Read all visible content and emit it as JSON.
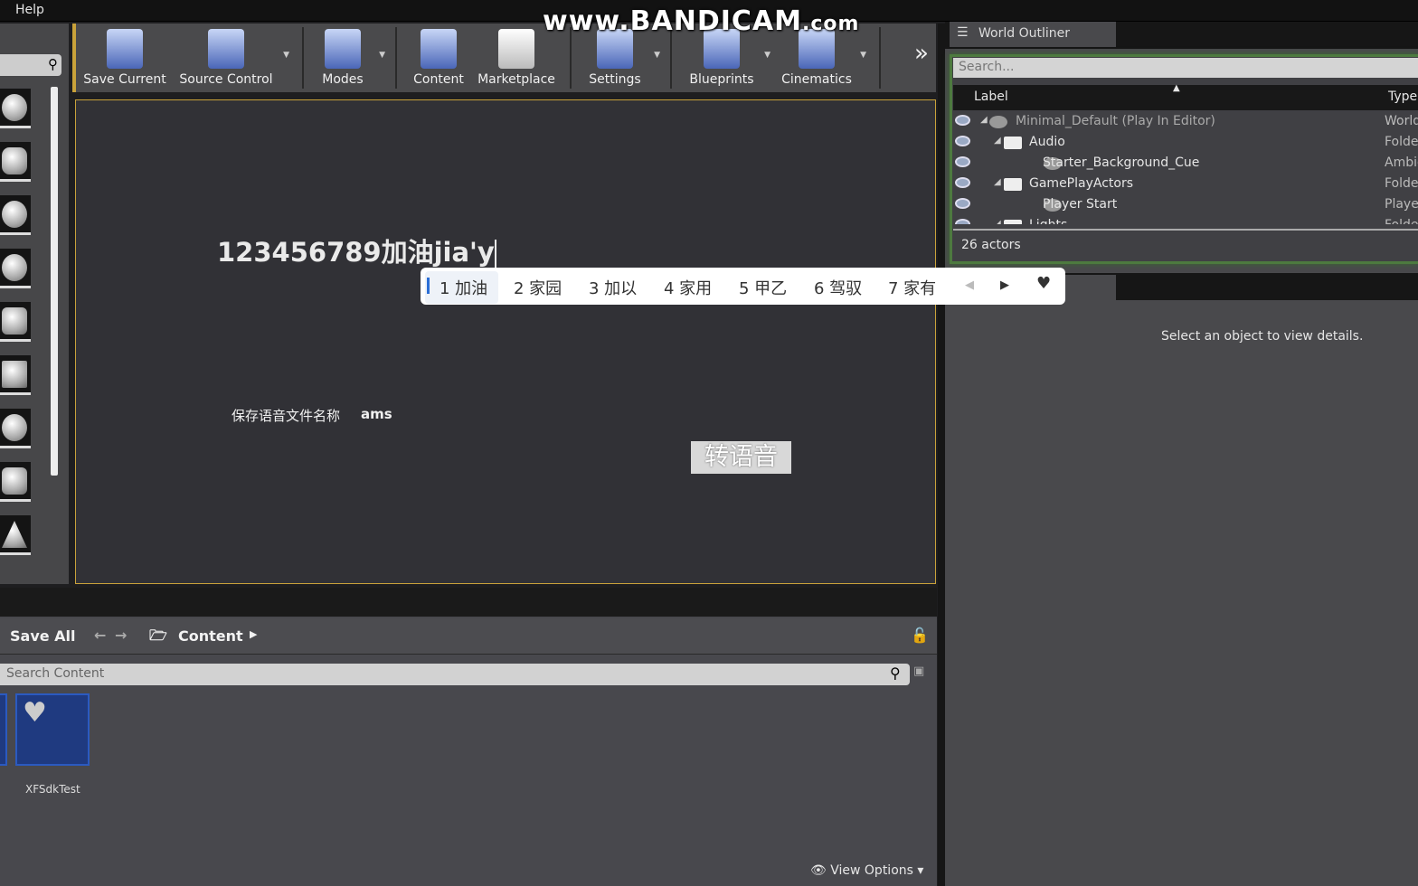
{
  "menu": {
    "help": "Help"
  },
  "watermark": {
    "main": "www.BANDICAM",
    "suffix": ".com"
  },
  "toolbar": {
    "items": [
      {
        "label": "Save Current",
        "icon": "save-icon",
        "dropdown": false
      },
      {
        "label": "Source Control",
        "icon": "source-control-icon",
        "dropdown": true
      },
      {
        "label": "Modes",
        "icon": "modes-icon",
        "dropdown": true
      },
      {
        "label": "Content",
        "icon": "content-icon",
        "dropdown": false
      },
      {
        "label": "Marketplace",
        "icon": "marketplace-icon",
        "dropdown": false
      },
      {
        "label": "Settings",
        "icon": "settings-icon",
        "dropdown": true
      },
      {
        "label": "Blueprints",
        "icon": "blueprints-icon",
        "dropdown": true
      },
      {
        "label": "Cinematics",
        "icon": "cinematics-icon",
        "dropdown": true
      }
    ],
    "more": "»"
  },
  "viewport": {
    "input_text": "123456789加油jia'y",
    "ime_candidates": [
      "1 加油",
      "2 家园",
      "3 加以",
      "4 家用",
      "5 甲乙",
      "6 驾驭",
      "7 家有"
    ],
    "save_label": "保存语音文件名称",
    "save_value": "ams",
    "convert_button": "转语音"
  },
  "content_browser": {
    "save_all": "Save All",
    "path": "Content",
    "search_placeholder": "Search Content",
    "assets": [
      {
        "name": "XFSdkTest"
      }
    ],
    "view_options": "View Options"
  },
  "world_outliner": {
    "tab": "World Outliner",
    "search_placeholder": "Search...",
    "columns": [
      "Label",
      "Type"
    ],
    "rows": [
      {
        "label": "Minimal_Default (Play In Editor)",
        "type": "World",
        "depth": 0,
        "kind": "world"
      },
      {
        "label": "Audio",
        "type": "Folder",
        "depth": 1,
        "kind": "folder"
      },
      {
        "label": "Starter_Background_Cue",
        "type": "AmbientSound",
        "depth": 2,
        "kind": "actor"
      },
      {
        "label": "GamePlayActors",
        "type": "Folder",
        "depth": 1,
        "kind": "folder"
      },
      {
        "label": "Player Start",
        "type": "PlayerStart",
        "depth": 2,
        "kind": "actor"
      },
      {
        "label": "Lights",
        "type": "Folder",
        "depth": 1,
        "kind": "folder"
      }
    ],
    "actor_count": "26 actors"
  },
  "details": {
    "empty_message": "Select an object to view details."
  },
  "colors": {
    "accent": "#c9a23a",
    "outliner_border": "#4d7a3f",
    "ime_highlight": "#2c6fd6"
  }
}
